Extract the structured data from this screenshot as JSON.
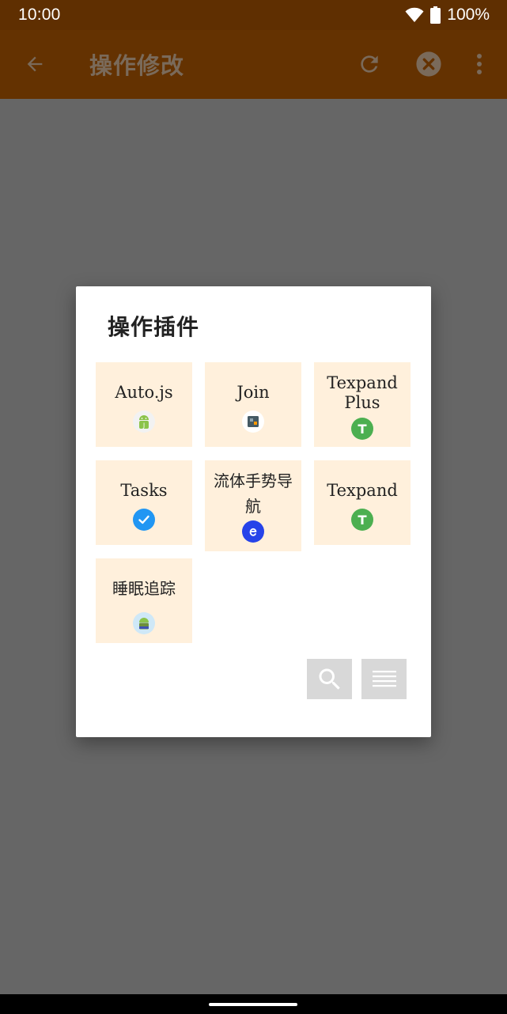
{
  "status_bar": {
    "time": "10:00",
    "battery": "100%"
  },
  "app_bar": {
    "title": "操作修改",
    "icons": [
      "arrow-back-icon",
      "undo-icon",
      "clear-icon",
      "more-vert-icon"
    ]
  },
  "dialog": {
    "title": "操作插件",
    "plugins": [
      {
        "label": "Auto.js",
        "icon": "autojs-icon"
      },
      {
        "label": "Join",
        "icon": "join-icon"
      },
      {
        "label": "Texpand Plus",
        "icon": "texpand-plus-icon"
      },
      {
        "label": "Tasks",
        "icon": "tasks-check-icon"
      },
      {
        "label": "流体手势导航",
        "icon": "fluid-gesture-icon"
      },
      {
        "label": "Texpand",
        "icon": "texpand-icon"
      },
      {
        "label": "睡眠追踪",
        "icon": "sleep-tracking-icon"
      }
    ],
    "buttons": [
      "search-icon",
      "list-icon"
    ]
  },
  "colors": {
    "status_bar": "#5f2f01",
    "app_bar": "#643201",
    "scrim": "#666666",
    "tile": "#fff0dc",
    "button": "#d8d8d8",
    "texpand_green": "#4caf50",
    "tasks_blue": "#2196f3",
    "fluid_blue": "#2643e9"
  }
}
